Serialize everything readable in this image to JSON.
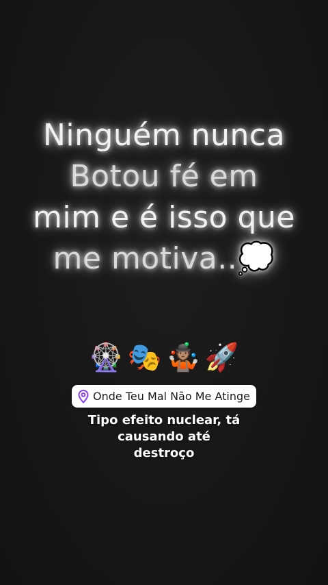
{
  "story": {
    "quote_lines": [
      "Ninguém nunca",
      "Botou fé em",
      "mim e é isso que",
      "me motiva..💭"
    ]
  },
  "stickers": {
    "emojis": [
      "🎡",
      "🎭",
      "🤹🏽",
      "🚀"
    ]
  },
  "location": {
    "label": "Onde Teu Mal Não Me Atinge",
    "icon": "location-pin-icon",
    "accent_color": "#8a3ffc"
  },
  "lyrics": {
    "lines": [
      "Tipo efeito nuclear, tá",
      "causando até",
      "destroço"
    ]
  }
}
